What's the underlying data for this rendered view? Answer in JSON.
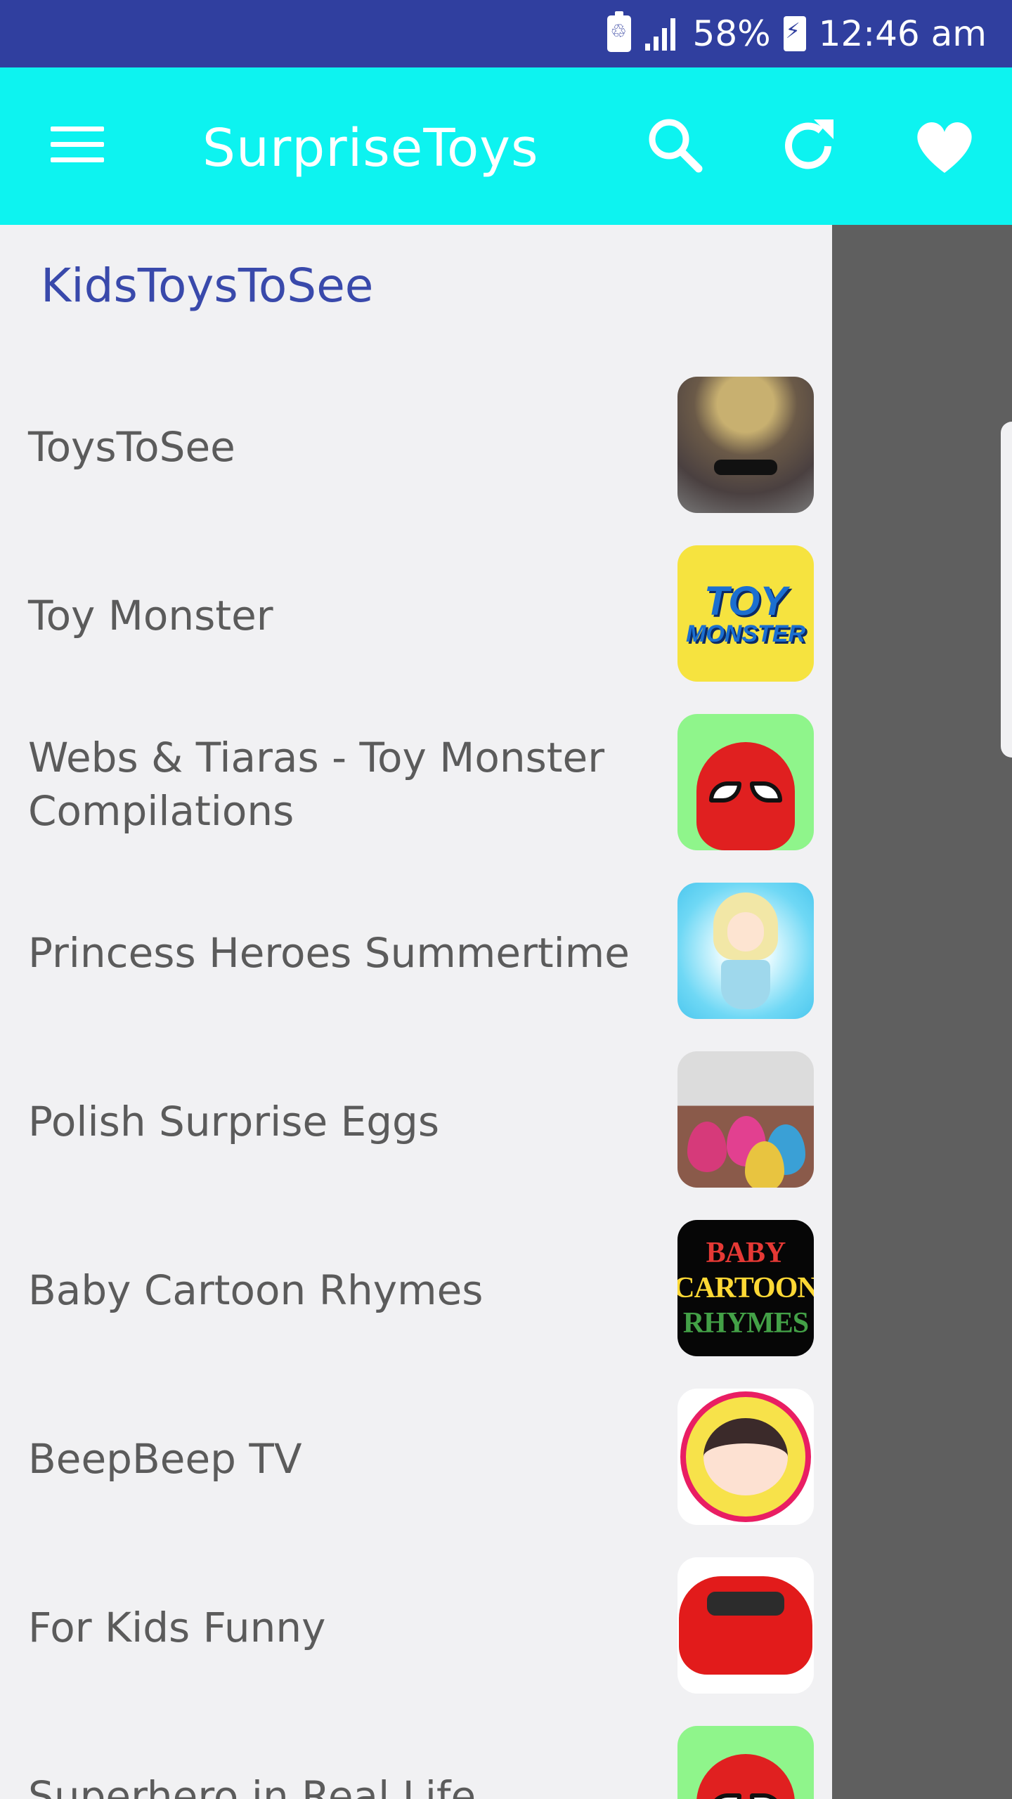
{
  "status_bar": {
    "battery_percent": "58%",
    "time": "12:46 am"
  },
  "app_bar": {
    "title": "SurpriseToys"
  },
  "drawer": {
    "header": "KidsToysToSee",
    "items": [
      {
        "label": "ToysToSee"
      },
      {
        "label": "Toy Monster",
        "thumb_text": [
          "TOY",
          "MONSTER"
        ]
      },
      {
        "label": "Webs & Tiaras - Toy Monster Compilations"
      },
      {
        "label": "Princess Heroes Summertime"
      },
      {
        "label": "Polish Surprise Eggs"
      },
      {
        "label": "Baby Cartoon Rhymes",
        "thumb_text": [
          "BABY",
          "CARTOON",
          "RHYMES"
        ]
      },
      {
        "label": "BeepBeep TV"
      },
      {
        "label": "For Kids Funny"
      },
      {
        "label": "Superhero in Real Life"
      }
    ]
  },
  "colors": {
    "status_bar": "#303f9f",
    "app_bar": "#0df3f0",
    "drawer_bg": "#f1f1f3",
    "header_text": "#3949ab",
    "scrim": "#5f5f5f"
  }
}
